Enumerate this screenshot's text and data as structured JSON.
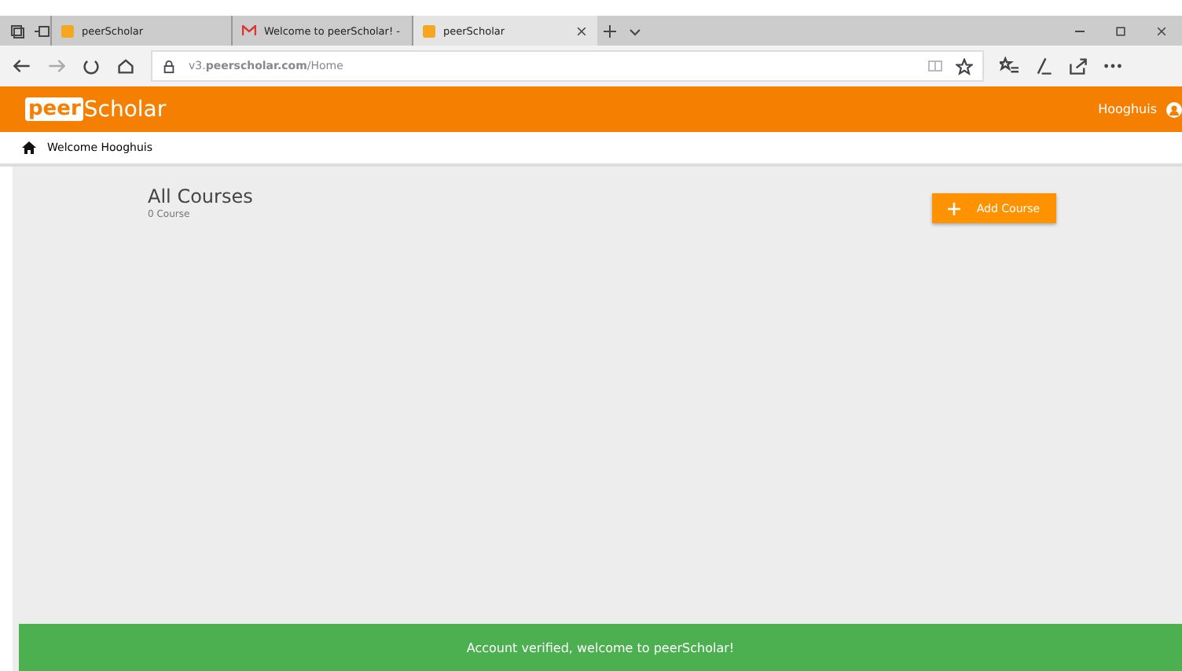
{
  "browser": {
    "tabs": [
      {
        "label": "peerScholar",
        "kind": "site",
        "selected": false
      },
      {
        "label": "Welcome to peerScholar! -",
        "kind": "mail",
        "selected": false
      },
      {
        "label": "peerScholar",
        "kind": "site",
        "selected": true
      }
    ],
    "address": "v3.**peerscholar.com**/Home"
  },
  "header": {
    "logo_box": "peer",
    "logo_text": "Scholar",
    "user": "Hooghuis"
  },
  "breadcrumb": "Welcome Hooghuis",
  "page": {
    "title": "All Courses",
    "count": "0 Course",
    "add_button": "Add Course"
  },
  "snackbar": "Account verified, welcome to peerScholar!"
}
